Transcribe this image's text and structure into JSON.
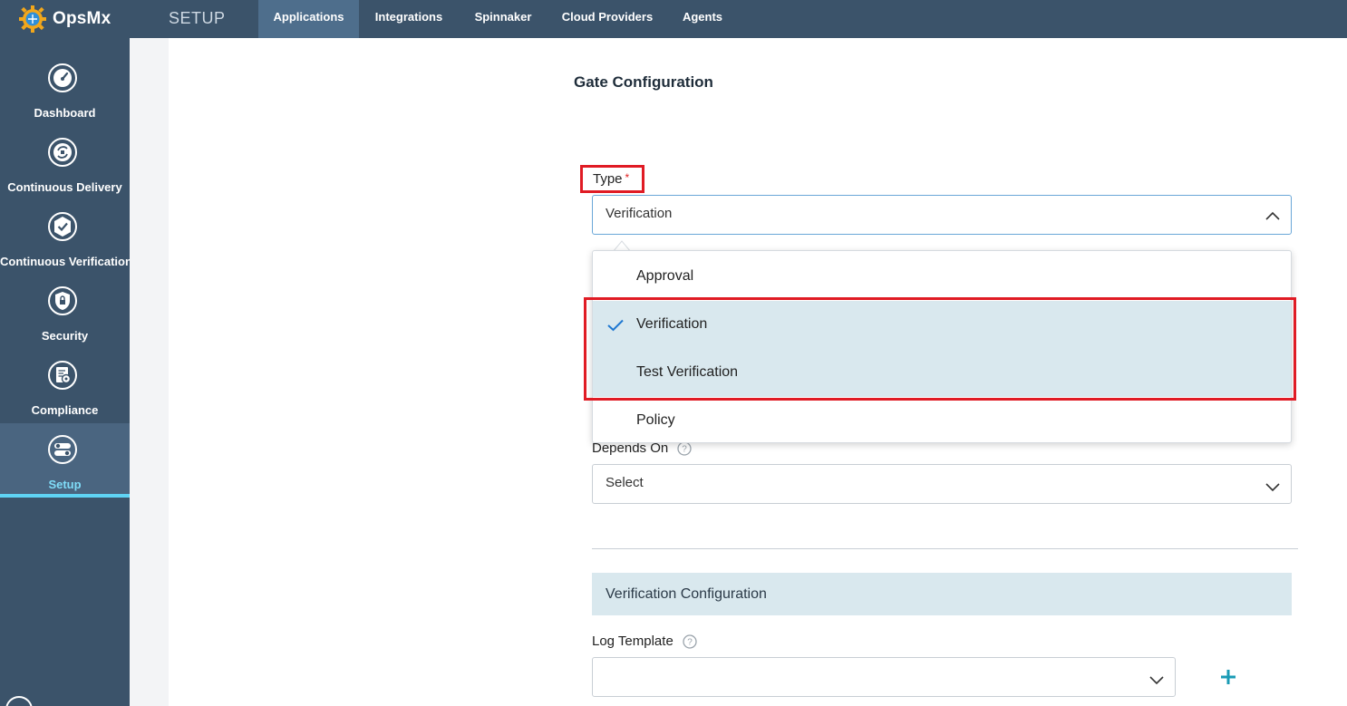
{
  "app": {
    "brand": "OpsMx",
    "section_title": "SETUP"
  },
  "nav": {
    "tabs": [
      {
        "label": "Applications",
        "active": true
      },
      {
        "label": "Integrations",
        "active": false
      },
      {
        "label": "Spinnaker",
        "active": false
      },
      {
        "label": "Cloud Providers",
        "active": false
      },
      {
        "label": "Agents",
        "active": false
      }
    ]
  },
  "sidebar": {
    "items": [
      {
        "label": "Dashboard",
        "icon": "gauge-icon"
      },
      {
        "label": "Continuous Delivery",
        "icon": "cycle-icon"
      },
      {
        "label": "Continuous Verification",
        "icon": "badge-check-icon"
      },
      {
        "label": "Security",
        "icon": "shield-lock-icon"
      },
      {
        "label": "Compliance",
        "icon": "document-gear-icon"
      },
      {
        "label": "Setup",
        "icon": "toggles-icon",
        "active": true
      }
    ]
  },
  "form": {
    "title": "Gate Configuration",
    "type": {
      "label": "Type",
      "required_mark": "*",
      "value": "Verification"
    },
    "type_options": [
      {
        "label": "Approval",
        "selected": false
      },
      {
        "label": "Verification",
        "selected": true
      },
      {
        "label": "Test Verification",
        "selected": false
      },
      {
        "label": "Policy",
        "selected": false
      }
    ],
    "depends_on": {
      "label": "Depends On",
      "value": "Select"
    },
    "verification_section": "Verification Configuration",
    "log_template": {
      "label": "Log Template",
      "value": ""
    }
  },
  "colors": {
    "topbar": "#3b536a",
    "active_tab": "#4e6e8c",
    "highlight": "#e01b24",
    "selected_row": "#d9e8ee",
    "accent": "#1a9bb5"
  }
}
